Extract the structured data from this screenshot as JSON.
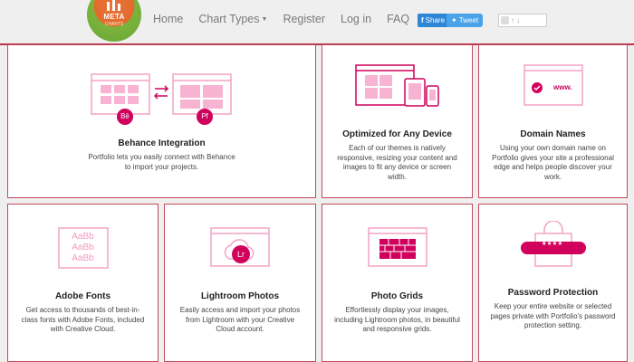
{
  "logo": {
    "text": "META",
    "subtext": "CHARTS"
  },
  "nav": {
    "home": "Home",
    "chart_types": "Chart Types",
    "register": "Register",
    "login": "Log in",
    "faq": "FAQ"
  },
  "social": {
    "share": "Share",
    "tweet": "Tweet"
  },
  "colors": {
    "accent": "#d1005d",
    "border": "#c44a5c",
    "icon_fill": "#f7b3d1"
  },
  "cards": [
    {
      "title": "Behance Integration",
      "text": "Portfolio lets you easily connect with Behance to import your projects.",
      "badge_a": "Bē",
      "badge_b": "Pf"
    },
    {
      "title": "Optimized for Any Device",
      "text": "Each of our themes is natively responsive, resizing your content and images to fit any device or screen width."
    },
    {
      "title": "Domain Names",
      "text": "Using your own domain name on Portfolio gives your site a professional edge and helps people discover your work.",
      "icon_text": "www."
    },
    {
      "title": "Adobe Fonts",
      "text": "Get access to thousands of best-in-class fonts with Adobe Fonts, included with Creative Cloud.",
      "icon_text": "AaBb"
    },
    {
      "title": "Lightroom Photos",
      "text": "Easily access and import your photos from Lightroom with your Creative Cloud account.",
      "badge": "Lr"
    },
    {
      "title": "Photo Grids",
      "text": "Effortlessly display your images, including Lightroom photos, in beautiful and responsive grids."
    },
    {
      "title": "Password Protection",
      "text": "Keep your entire website or selected pages private with Portfolio's password protection setting.",
      "icon_text": "****"
    }
  ]
}
